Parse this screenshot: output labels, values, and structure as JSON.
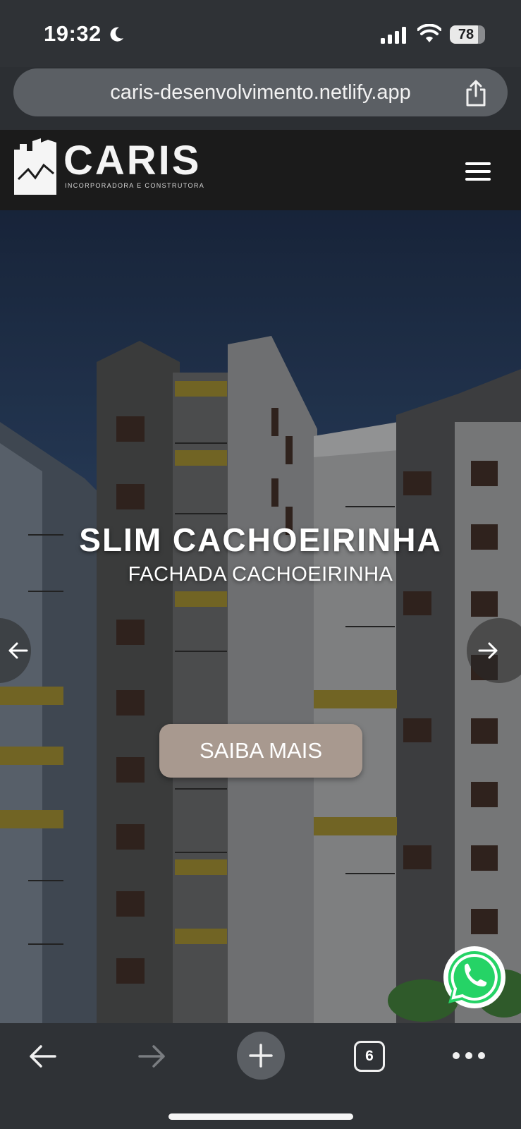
{
  "status_bar": {
    "time": "19:32",
    "battery": "78",
    "battery_level": 0.78,
    "icons": [
      "moon-icon",
      "signal-icon",
      "wifi-icon",
      "battery-icon"
    ]
  },
  "browser": {
    "url": "caris-desenvolvimento.netlify.app",
    "tab_count": "6",
    "icons": [
      "share-icon",
      "back-arrow-icon",
      "forward-arrow-icon",
      "plus-icon",
      "tabs-icon",
      "more-icon"
    ]
  },
  "header": {
    "logo_name": "CARIS",
    "logo_tagline": "INCORPORADORA E CONSTRUTORA",
    "menu_icon": "hamburger-menu-icon"
  },
  "hero": {
    "title": "SLIM CACHOEIRINHA",
    "subtitle": "FACHADA CACHOEIRINHA",
    "cta_label": "SAIBA MAIS",
    "prev_icon": "arrow-left-icon",
    "next_icon": "arrow-right-icon"
  },
  "floating": {
    "whatsapp_icon": "whatsapp-icon",
    "whatsapp_color": "#25D366"
  },
  "colors": {
    "header_bg": "#1b1b1b",
    "cta_bg": "#a8998f",
    "browser_chrome": "#2f3236"
  }
}
